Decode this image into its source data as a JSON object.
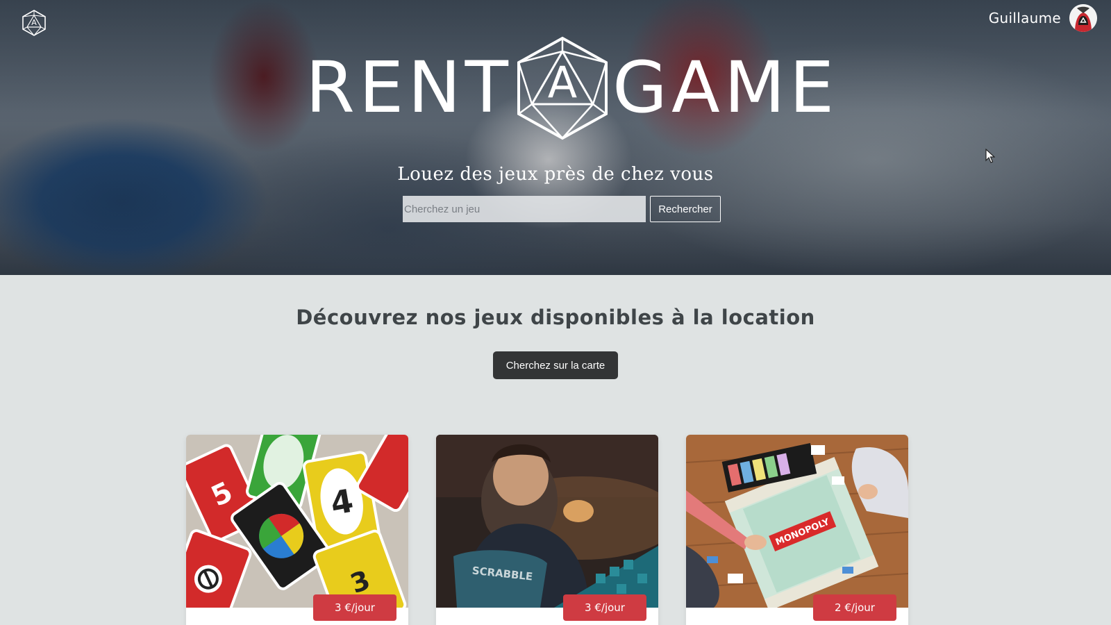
{
  "header": {
    "user_name": "Guillaume",
    "brand_left": "RENT",
    "brand_right": "GAME",
    "brand_die_letter": "A",
    "tagline": "Louez des jeux près de chez vous"
  },
  "search": {
    "placeholder": "Cherchez un jeu",
    "value": "",
    "button_label": "Rechercher"
  },
  "main": {
    "title": "Découvrez nos jeux disponibles à la location",
    "map_button_label": "Cherchez sur la carte"
  },
  "games": [
    {
      "image": "uno-cards",
      "price": "3 €/jour"
    },
    {
      "image": "scrabble-boy",
      "price": "3 €/jour"
    },
    {
      "image": "monopoly-board",
      "price": "2 €/jour"
    }
  ],
  "icons": {
    "corner": "d20-logo-icon",
    "avatar": "hooded-avatar-icon",
    "cursor": "mouse-cursor-icon"
  },
  "colors": {
    "accent_red": "#cf3b42",
    "dark_button": "#333536",
    "page_bg": "#dfe3e3",
    "title_text": "#3f4548"
  }
}
